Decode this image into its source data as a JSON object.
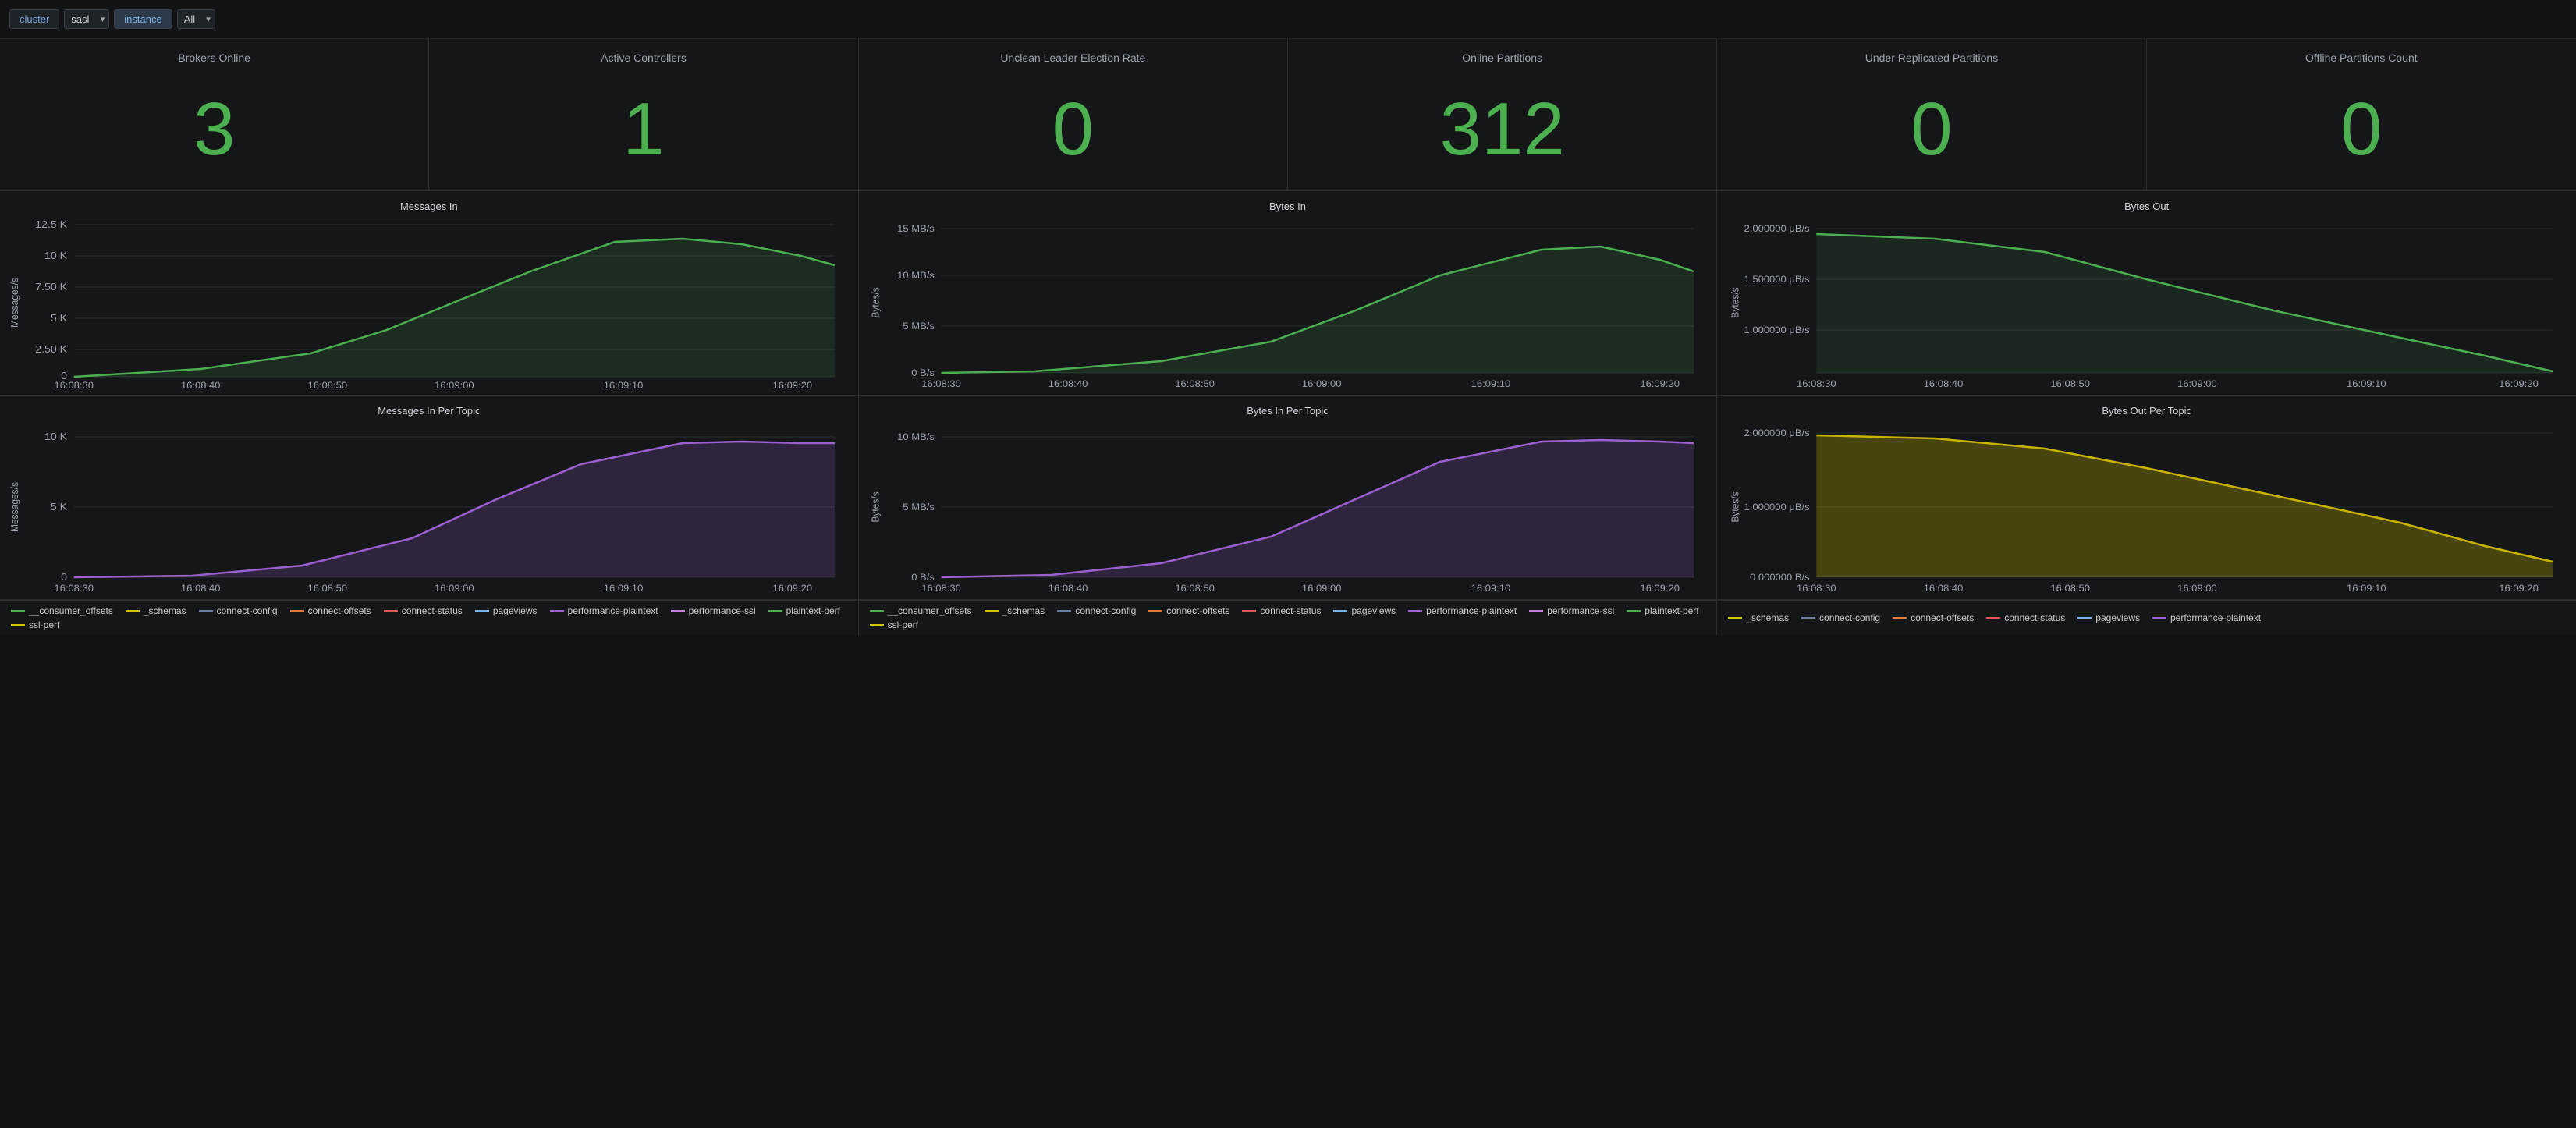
{
  "nav": {
    "cluster_label": "cluster",
    "sasl_label": "sasl",
    "instance_label": "instance",
    "all_label": "All"
  },
  "stats": [
    {
      "id": "brokers-online",
      "title": "Brokers Online",
      "value": "3"
    },
    {
      "id": "active-controllers",
      "title": "Active Controllers",
      "value": "1"
    },
    {
      "id": "unclean-election",
      "title": "Unclean Leader Election Rate",
      "value": "0"
    },
    {
      "id": "online-partitions",
      "title": "Online Partitions",
      "value": "312"
    },
    {
      "id": "under-replicated",
      "title": "Under Replicated Partitions",
      "value": "0"
    },
    {
      "id": "offline-count",
      "title": "Offline Partitions Count",
      "value": "0"
    }
  ],
  "charts_row1": [
    {
      "id": "messages-in",
      "title": "Messages In",
      "y_label": "Messages/s",
      "y_ticks": [
        "12.5 K",
        "10 K",
        "7.50 K",
        "5 K",
        "2.50 K",
        "0"
      ],
      "x_ticks": [
        "16:08:30",
        "16:08:40",
        "16:08:50",
        "16:09:00",
        "16:09:10",
        "16:09:20"
      ]
    },
    {
      "id": "bytes-in",
      "title": "Bytes In",
      "y_label": "Bytes/s",
      "y_ticks": [
        "15 MB/s",
        "10 MB/s",
        "5 MB/s",
        "0 B/s"
      ],
      "x_ticks": [
        "16:08:30",
        "16:08:40",
        "16:08:50",
        "16:09:00",
        "16:09:10",
        "16:09:20"
      ]
    },
    {
      "id": "bytes-out",
      "title": "Bytes Out",
      "y_label": "Bytes/s",
      "y_ticks": [
        "2.000000 μB/s",
        "1.500000 μB/s",
        "1.000000 μB/s"
      ],
      "x_ticks": [
        "16:08:30",
        "16:08:40",
        "16:08:50",
        "16:09:00",
        "16:09:10",
        "16:09:20"
      ]
    }
  ],
  "charts_row2": [
    {
      "id": "messages-in-per-topic",
      "title": "Messages In Per Topic",
      "y_label": "Messages/s",
      "y_ticks": [
        "10 K",
        "5 K",
        "0"
      ],
      "x_ticks": [
        "16:08:30",
        "16:08:40",
        "16:08:50",
        "16:09:00",
        "16:09:10",
        "16:09:20"
      ]
    },
    {
      "id": "bytes-in-per-topic",
      "title": "Bytes In Per Topic",
      "y_label": "Bytes/s",
      "y_ticks": [
        "10 MB/s",
        "5 MB/s",
        "0 B/s"
      ],
      "x_ticks": [
        "16:08:30",
        "16:08:40",
        "16:08:50",
        "16:09:00",
        "16:09:10",
        "16:09:20"
      ]
    },
    {
      "id": "bytes-out-per-topic",
      "title": "Bytes Out Per Topic",
      "y_label": "Bytes/s",
      "y_ticks": [
        "2.000000 μB/s",
        "1.000000 μB/s",
        "0.000000 B/s"
      ],
      "x_ticks": [
        "16:08:30",
        "16:08:40",
        "16:08:50",
        "16:09:00",
        "16:09:10",
        "16:09:20"
      ]
    }
  ],
  "legend_row1": [
    {
      "label": "__consumer_offsets",
      "color": "#4caf50"
    },
    {
      "label": "_schemas",
      "color": "#d4c300"
    },
    {
      "label": "connect-config",
      "color": "#6b7fa3"
    },
    {
      "label": "connect-offsets",
      "color": "#e07b39"
    },
    {
      "label": "connect-status",
      "color": "#e05555"
    },
    {
      "label": "pageviews",
      "color": "#7ab3e8"
    },
    {
      "label": "performance-plaintext",
      "color": "#9c60d0"
    },
    {
      "label": "performance-ssl",
      "color": "#c77ddb"
    },
    {
      "label": "plaintext-perf",
      "color": "#4caf50"
    },
    {
      "label": "ssl-perf",
      "color": "#d4c300"
    }
  ],
  "legend_row2_col3": [
    {
      "label": "_schemas",
      "color": "#d4c300"
    },
    {
      "label": "connect-config",
      "color": "#6b7fa3"
    },
    {
      "label": "connect-offsets",
      "color": "#e07b39"
    },
    {
      "label": "connect-status",
      "color": "#e05555"
    },
    {
      "label": "pageviews",
      "color": "#7ab3e8"
    },
    {
      "label": "performance-plaintext",
      "color": "#9c60d0"
    }
  ]
}
